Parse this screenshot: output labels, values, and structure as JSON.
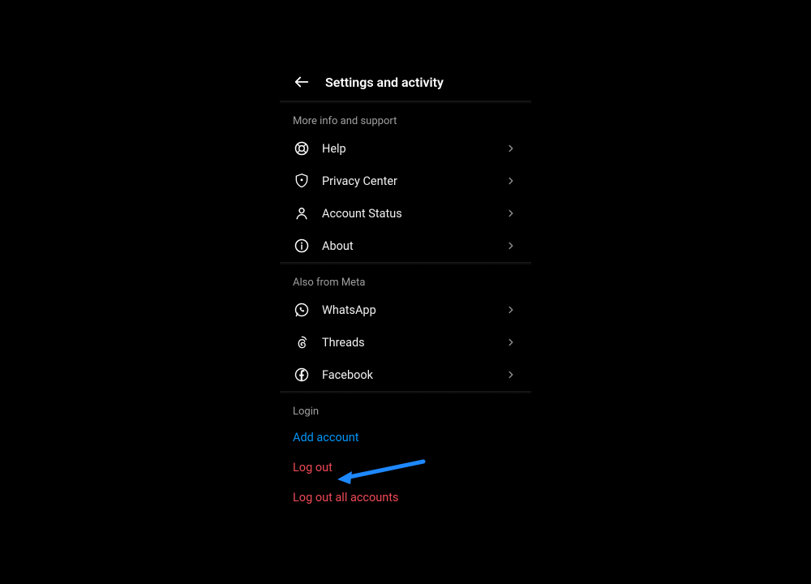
{
  "header": {
    "title": "Settings and activity"
  },
  "sections": {
    "support": {
      "title": "More info and support",
      "items": [
        {
          "label": "Help"
        },
        {
          "label": "Privacy Center"
        },
        {
          "label": "Account Status"
        },
        {
          "label": "About"
        }
      ]
    },
    "meta": {
      "title": "Also from Meta",
      "items": [
        {
          "label": "WhatsApp"
        },
        {
          "label": "Threads"
        },
        {
          "label": "Facebook"
        }
      ]
    },
    "login": {
      "title": "Login",
      "add_account": "Add account",
      "log_out": "Log out",
      "log_out_all": "Log out all accounts"
    }
  }
}
